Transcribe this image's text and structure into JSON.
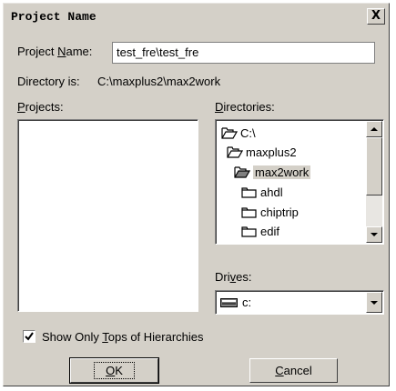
{
  "window": {
    "title": "Project Name",
    "close_glyph": "X"
  },
  "project_name": {
    "label_pre": "Project ",
    "label_key": "N",
    "label_post": "ame:",
    "value": "test_fre\\test_fre"
  },
  "directory": {
    "label": "Directory is:",
    "path": "C:\\maxplus2\\max2work"
  },
  "projects": {
    "label_key": "P",
    "label_post": "rojects:",
    "items": []
  },
  "directories": {
    "label_key": "D",
    "label_post": "irectories:",
    "items": [
      {
        "name": "C:\\",
        "icon": "open-folder-icon"
      },
      {
        "name": "maxplus2",
        "icon": "open-folder-icon"
      },
      {
        "name": "max2work",
        "icon": "open-folder-icon",
        "selected": true
      },
      {
        "name": "ahdl",
        "icon": "folder-icon"
      },
      {
        "name": "chiptrip",
        "icon": "folder-icon"
      },
      {
        "name": "edif",
        "icon": "folder-icon"
      }
    ]
  },
  "drives": {
    "label_pre": "Dri",
    "label_key": "v",
    "label_post": "es:",
    "value": "c:",
    "icon": "drive-icon"
  },
  "show_tops": {
    "checked": true,
    "label_pre": "Show Only ",
    "label_key": "T",
    "label_post": "ops of Hierarchies"
  },
  "buttons": {
    "ok_key": "O",
    "ok_post": "K",
    "cancel_key": "C",
    "cancel_post": "ancel"
  },
  "colors": {
    "face": "#d4d0c8",
    "window": "#ffffff"
  }
}
